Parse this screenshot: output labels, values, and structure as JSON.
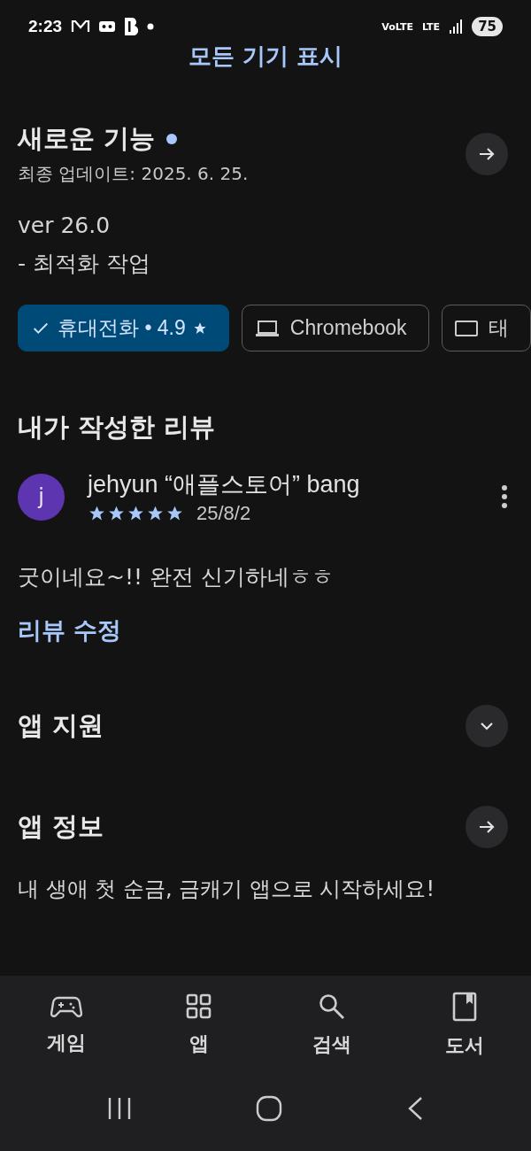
{
  "status_bar": {
    "time": "2:23",
    "network": [
      "VoLTE",
      "LTE"
    ],
    "battery": "75"
  },
  "show_all_devices": "모든 기기 표시",
  "whats_new": {
    "title": "새로운 기능",
    "has_new": true,
    "updated": "최종 업데이트: 2025. 6. 25.",
    "lines": [
      "ver 26.0",
      "- 최적화 작업"
    ]
  },
  "devices": [
    {
      "kind": "phone",
      "label": "휴대전화 • 4.9",
      "selected": true
    },
    {
      "kind": "laptop",
      "label": "Chromebook",
      "selected": false
    },
    {
      "kind": "tablet",
      "label": "태",
      "selected": false
    }
  ],
  "my_review": {
    "title": "내가 작성한 리뷰",
    "avatar": "j",
    "author": "jehyun “애플스토어” bang",
    "stars": 5,
    "date": "25/8/2",
    "text": "굿이네요~!! 완전 신기하네ㅎㅎ",
    "edit": "리뷰 수정"
  },
  "sections": [
    {
      "kind": "expand",
      "title": "앱 지원",
      "expanded": false
    },
    {
      "kind": "link",
      "title": "앱 정보",
      "description": "내 생애 첫 순금, 금캐기 앱으로 시작하세요!"
    }
  ],
  "bottom_nav": [
    {
      "kind": "games",
      "label": "게임",
      "selected": false
    },
    {
      "kind": "apps",
      "label": "앱",
      "selected": false
    },
    {
      "kind": "search",
      "label": "검색",
      "selected": false
    },
    {
      "kind": "books",
      "label": "도서",
      "selected": false
    }
  ]
}
